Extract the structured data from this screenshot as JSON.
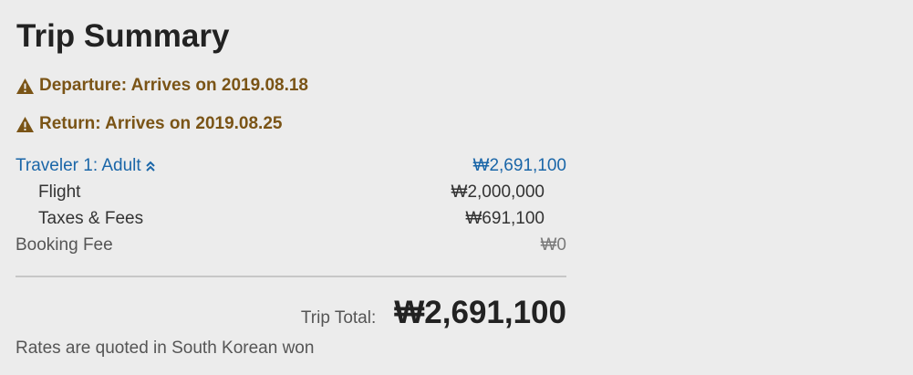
{
  "summary": {
    "title": "Trip Summary",
    "departure_notice": "Departure: Arrives on 2019.08.18",
    "return_notice": "Return: Arrives on 2019.08.25",
    "traveler": {
      "label": "Traveler 1: Adult",
      "amount": "₩2,691,100",
      "icon": "chevron-double-up-icon"
    },
    "line_items": [
      {
        "label": "Flight",
        "amount": "₩2,000,000"
      },
      {
        "label": "Taxes & Fees",
        "amount": "₩691,100"
      }
    ],
    "booking_fee": {
      "label": "Booking Fee",
      "amount": "₩0"
    },
    "total": {
      "label": "Trip Total:",
      "amount": "₩2,691,100"
    },
    "currency_note": "Rates are quoted in South Korean won"
  },
  "colors": {
    "background": "#ececec",
    "alert": "#7a5416",
    "link": "#1a66a8",
    "text": "#333333"
  }
}
